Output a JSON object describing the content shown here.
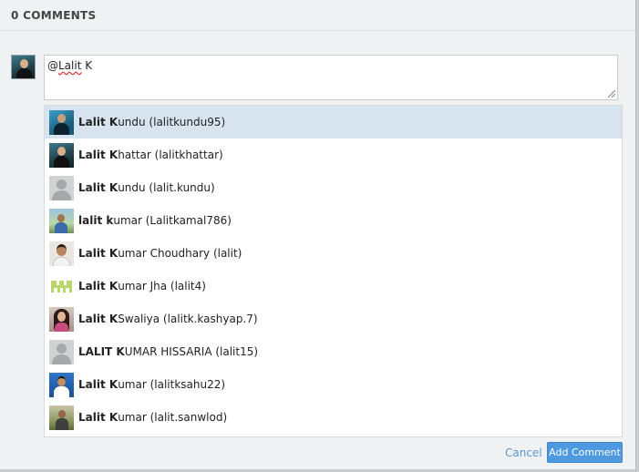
{
  "header": {
    "title": "0 COMMENTS"
  },
  "composer": {
    "text_prefix": "@",
    "mention_text": "Lalit",
    "text_suffix": " K",
    "cancel_label": "Cancel",
    "submit_label": "Add Comment"
  },
  "suggestions": [
    {
      "bold": "Lalit K",
      "rest": "undu (lalitkundu95)",
      "avatar": "teal-photo-avatar",
      "active": true
    },
    {
      "bold": "Lalit K",
      "rest": "hattar (lalitkhattar)",
      "avatar": "dark-photo-avatar",
      "active": false
    },
    {
      "bold": "Lalit K",
      "rest": "undu (lalit.kundu)",
      "avatar": "default-user-avatar",
      "active": false
    },
    {
      "bold": "lalit k",
      "rest": "umar (Lalitkamal786)",
      "avatar": "outdoor-photo-avatar",
      "active": false
    },
    {
      "bold": "Lalit K",
      "rest": "umar Choudhary (lalit)",
      "avatar": "portrait-photo-avatar",
      "active": false
    },
    {
      "bold": "Lalit K",
      "rest": "umar Jha (lalit4)",
      "avatar": "green-identicon-avatar",
      "active": false
    },
    {
      "bold": "Lalit K",
      "rest": " Swaliya (lalitk.kashyap.7)",
      "avatar": "woman-photo-avatar",
      "active": false
    },
    {
      "bold": "LALIT K",
      "rest": "UMAR HISSARIA (lalit15)",
      "avatar": "default-user-avatar",
      "active": false
    },
    {
      "bold": "Lalit K",
      "rest": "umar (lalitksahu22)",
      "avatar": "blue-photo-avatar",
      "active": false
    },
    {
      "bold": "Lalit K",
      "rest": "umar (lalit.sanwlod)",
      "avatar": "field-photo-avatar",
      "active": false
    }
  ],
  "colors": {
    "active_row": "#d7e3ef",
    "button": "#4d9ae0",
    "link": "#5b97cf"
  }
}
